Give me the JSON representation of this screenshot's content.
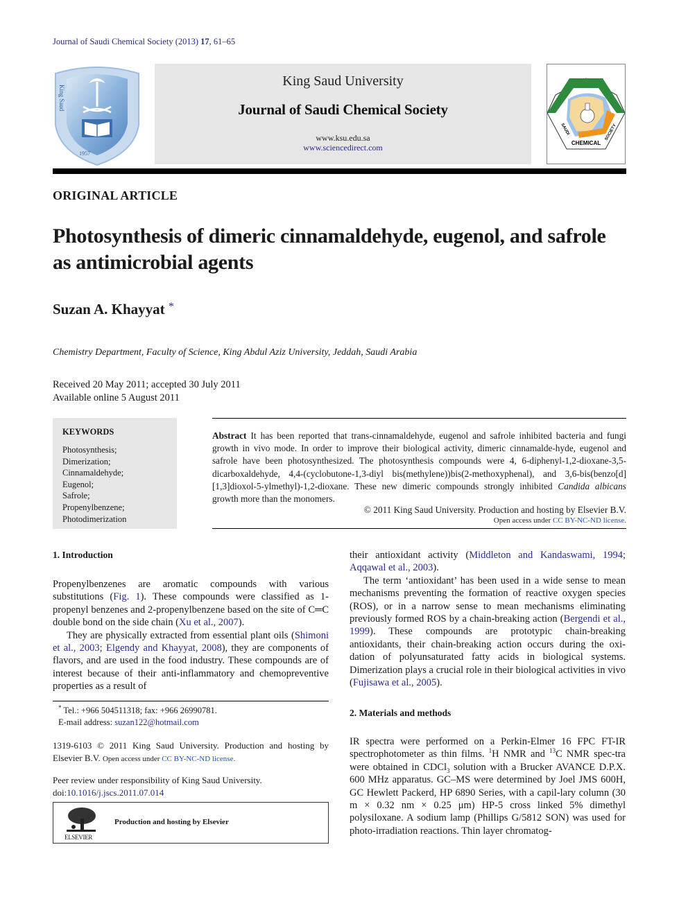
{
  "journal_ref": {
    "prefix": "Journal of Saudi Chemical Society (2013) ",
    "volume": "17",
    "pages": ", 61–65"
  },
  "banner": {
    "university": "King Saud University",
    "journal_name": "Journal of Saudi Chemical Society",
    "url_ksu": "www.ksu.edu.sa",
    "url_sd": "www.sciencedirect.com"
  },
  "logos": {
    "ksu": {
      "text_left": "King Saud University 1957",
      "colors": {
        "shield": "#6f9fd2",
        "shield_light": "#b9d1ea"
      }
    },
    "scs": {
      "bottom_text": "CHEMICAL",
      "left_text": "SAUDI",
      "right_text": "SOCIETY",
      "colors": {
        "green": "#2e8b3e",
        "orange": "#f0921c",
        "sand": "#f5d89a",
        "blue": "#9ec3e6"
      }
    }
  },
  "article_type": "ORIGINAL ARTICLE",
  "title": "Photosynthesis of dimeric cinnamaldehyde, eugenol, and safrole as antimicrobial agents",
  "author": {
    "name": "Suzan A. Khayyat",
    "mark": "*"
  },
  "affiliation": "Chemistry Department, Faculty of Science, King Abdul Aziz University, Jeddah, Saudi Arabia",
  "dates": {
    "received": "Received 20 May 2011; accepted 30 July 2011",
    "online": "Available online 5 August 2011"
  },
  "keywords": {
    "heading": "KEYWORDS",
    "items": [
      "Photosynthesis;",
      "Dimerization;",
      "Cinnamaldehyde;",
      "Eugenol;",
      "Safrole;",
      "Propenylbenzene;",
      "Photodimerization"
    ]
  },
  "abstract": {
    "label": "Abstract",
    "text_1": "It has been reported that trans-cinnamaldehyde, eugenol and safrole inhibited bacteria and fungi growth in vivo mode. In order to improve their biological activity, dimeric cinnamalde-hyde, eugenol and safrole have been photosynthesized. The photosynthesis compounds were 4, 6-diphenyl-1,2-dioxane-3,5-dicarboxaldehyde, 4,4-(cyclobutone-1,3-diyl bis(methylene))bis(2-methoxyphenal), and 3,6-bis(benzo[d][1,3]dioxol-5-ylmethyl)-1,2-dioxane. These new dimeric compounds strongly inhibited ",
    "species": "Candida albicans",
    "text_2": " growth more than the monomers.",
    "copyright": "© 2011 King Saud University. Production and hosting by Elsevier B.V.",
    "open_access_prefix": "Open access under ",
    "license": "CC BY-NC-ND license."
  },
  "intro": {
    "heading": "1. Introduction",
    "p1": {
      "a": "Propenylbenzenes are aromatic compounds with various substitutions (",
      "ref1": "Fig. 1",
      "b": "). These compounds were classified as 1-propenyl benzenes and 2-propenylbenzene based on the site of C═C double bond on the side chain (",
      "ref2": "Xu et al., 2007",
      "c": ")."
    },
    "p2": {
      "a": "They are physically extracted from essential plant oils (",
      "ref1": "Shimoni et al., 2003; Elgendy and Khayyat, 2008",
      "b": "), they are components of flavors, and are used in the food industry. These compounds are of interest because of their anti-inflammatory and chemopreventive properties as a result of"
    }
  },
  "right_col": {
    "p1": {
      "a": "their antioxidant activity (",
      "ref1": "Middleton and Kandaswami, 1994; Aqqawal et al., 2003",
      "b": ")."
    },
    "p2": {
      "a": "The term ‘antioxidant’ has been used in a wide sense to mean mechanisms preventing the formation of reactive oxygen species (ROS), or in a narrow sense to mean mechanisms eliminating previously formed ROS by a chain-breaking action (",
      "ref1": "Bergendi et al., 1999",
      "b": "). These compounds are prototypic chain-breaking antioxidants, their chain-breaking action occurs during the oxi-dation of polyunsaturated fatty acids in biological systems. Dimerization plays a crucial role in their biological activities in vivo (",
      "ref2": "Fujisawa et al., 2005",
      "c": ")."
    }
  },
  "methods": {
    "heading": "2. Materials and methods",
    "a": "IR spectra were performed on a Perkin-Elmer 16 FPC FT-IR spectrophotometer as thin films. ",
    "sup1": "1",
    "b": "H NMR and ",
    "sup2": "13",
    "c": "C NMR spec-tra were obtained in CDCl",
    "sub1": "3",
    "d": " solution with a Brucker AVANCE D.P.X. 600 MHz apparatus. GC–MS were determined by Joel JMS 600H, GC Hewlett Packerd, HP 6890 Series, with a capil-lary column (30 m × 0.32 nm × 0.25 μm) HP-5 cross linked 5% dimethyl polysiloxane. A sodium lamp (Phillips G/5812 SON) was used for photo-irradiation reactions. Thin layer chromatog-"
  },
  "footnote": {
    "mark": "*",
    "contact": "Tel.: +966 504511318; fax: +966 26990781.",
    "email_label": "E-mail address: ",
    "email": "suzan122@hotmail.com"
  },
  "issn": {
    "text": "1319-6103 © 2011 King Saud University. Production and hosting by Elsevier B.V. ",
    "open_access_prefix": "Open access under ",
    "license": "CC BY-NC-ND license."
  },
  "peer_review": {
    "text": "Peer review under responsibility of King Saud University.",
    "doi_prefix": "doi:",
    "doi": "10.1016/j.jscs.2011.07.014"
  },
  "elsevier_box": {
    "text": "Production and hosting by Elsevier",
    "logo_word": "ELSEVIER"
  }
}
